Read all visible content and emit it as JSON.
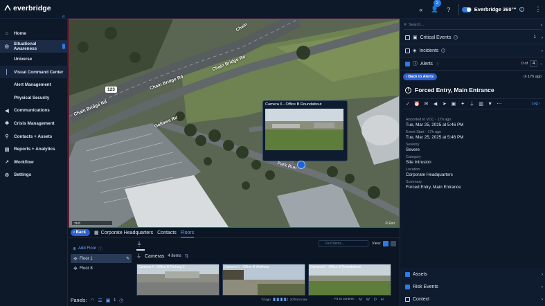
{
  "app": {
    "logo_text": "everbridge",
    "brand_color": "#2c7be5"
  },
  "topbar": {
    "notification_count": "2",
    "product_label": "Everbridge 360™"
  },
  "sidebar": {
    "items": [
      {
        "label": "Home",
        "icon": "home-icon"
      },
      {
        "label": "Situational Awareness",
        "icon": "radar-icon",
        "active": true
      },
      {
        "label": "Universe",
        "sub": true
      },
      {
        "label": "Visual Command Center",
        "sub": true,
        "selected": true
      },
      {
        "label": "Alert Management",
        "sub": true
      },
      {
        "label": "Physical Security",
        "sub": true
      },
      {
        "label": "Communications",
        "icon": "megaphone-icon"
      },
      {
        "label": "Crisis Management",
        "icon": "crisis-icon"
      },
      {
        "label": "Contacts + Assets",
        "icon": "contacts-icon"
      },
      {
        "label": "Reports + Analytics",
        "icon": "reports-icon"
      },
      {
        "label": "Workflow",
        "icon": "workflow-icon"
      },
      {
        "label": "Settings",
        "icon": "gear-icon"
      }
    ]
  },
  "map": {
    "road_labels": [
      "Chain Bridge Rd",
      "Chain Bridge Rd",
      "Chain Bridge Rd",
      "Chain",
      "Gallows Rd",
      "Park Run"
    ],
    "route_shield": "123",
    "popup_title": "Camera 6 - Office B Roundabout",
    "scale_label": "75 ft",
    "attribution": "© Esri"
  },
  "bottom": {
    "back_label": "Back",
    "breadcrumbs": [
      "Corporate Headquarters",
      "Contacts",
      "Floors"
    ],
    "add_floor_label": "Add Floor",
    "floors": [
      "Floor 1",
      "Floor 8"
    ],
    "search_placeholder": "Find items...",
    "view_label": "View:",
    "cameras_label": "Cameras",
    "cameras_count": "4 items",
    "cameras": [
      "Camera 4 - Office B Parking 2",
      "Camera 5 - Office B Walkway",
      "Camera 6 - Office B Roundabout"
    ],
    "panels_label": "Panels:",
    "panels_count": "1",
    "timeline_start": "7d ago",
    "timeline_end": "2d from now",
    "fit_label": "Fit to content:",
    "fit_keys": [
      "M",
      "W",
      "D",
      "H"
    ]
  },
  "right": {
    "search_placeholder": "Search...",
    "sections": [
      {
        "label": "Critical Events",
        "count": "1"
      },
      {
        "label": "Incidents",
        "count": ""
      }
    ],
    "alerts": {
      "label": "Alerts",
      "page_of": "0 of",
      "page_total": "4",
      "back_label": "Back to Alerts",
      "ago": "17h ago",
      "title": "Forced Entry, Main Entrance",
      "log_label": "Log",
      "details": [
        {
          "label": "Reported to VCC - 17h ago",
          "value": "Tue, Mar 25, 2025 at 5:46 PM"
        },
        {
          "label": "Event Start - 17h ago",
          "value": "Tue, Mar 25, 2025 at 5:46 PM"
        },
        {
          "label": "Severity",
          "value": "Severe"
        },
        {
          "label": "Category",
          "value": "Site Intrusion"
        },
        {
          "label": "Location",
          "value": "Corporate Headquarters"
        },
        {
          "label": "Summary",
          "value": "Forced Entry, Main Entrance"
        }
      ]
    },
    "bottom_sections": [
      "Assets",
      "Risk Events",
      "Context"
    ]
  }
}
